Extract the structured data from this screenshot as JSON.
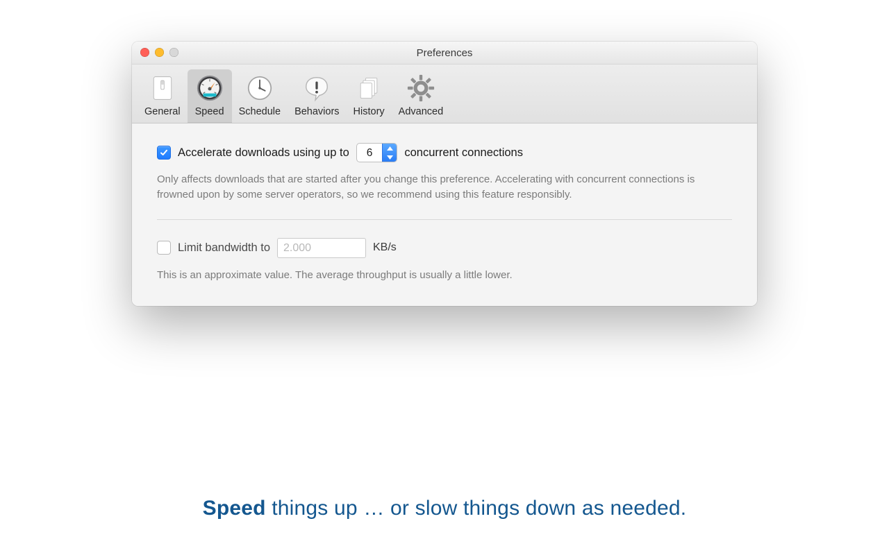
{
  "window": {
    "title": "Preferences"
  },
  "toolbar": {
    "general": "General",
    "speed": "Speed",
    "schedule": "Schedule",
    "behaviors": "Behaviors",
    "history": "History",
    "advanced": "Advanced"
  },
  "accelerate": {
    "label_before": "Accelerate downloads using up to",
    "value": "6",
    "label_after": "concurrent connections",
    "help": "Only affects downloads that are started after you change this preference. Accelerating with concurrent connections is frowned upon by some server operators, so we recommend using this feature responsibly."
  },
  "bandwidth": {
    "label": "Limit bandwidth to",
    "value": "2.000",
    "unit": "KB/s",
    "help": "This is an approximate value. The average throughput is usually a little lower."
  },
  "caption": {
    "bold": "Speed",
    "rest": " things up … or slow things down as needed."
  }
}
